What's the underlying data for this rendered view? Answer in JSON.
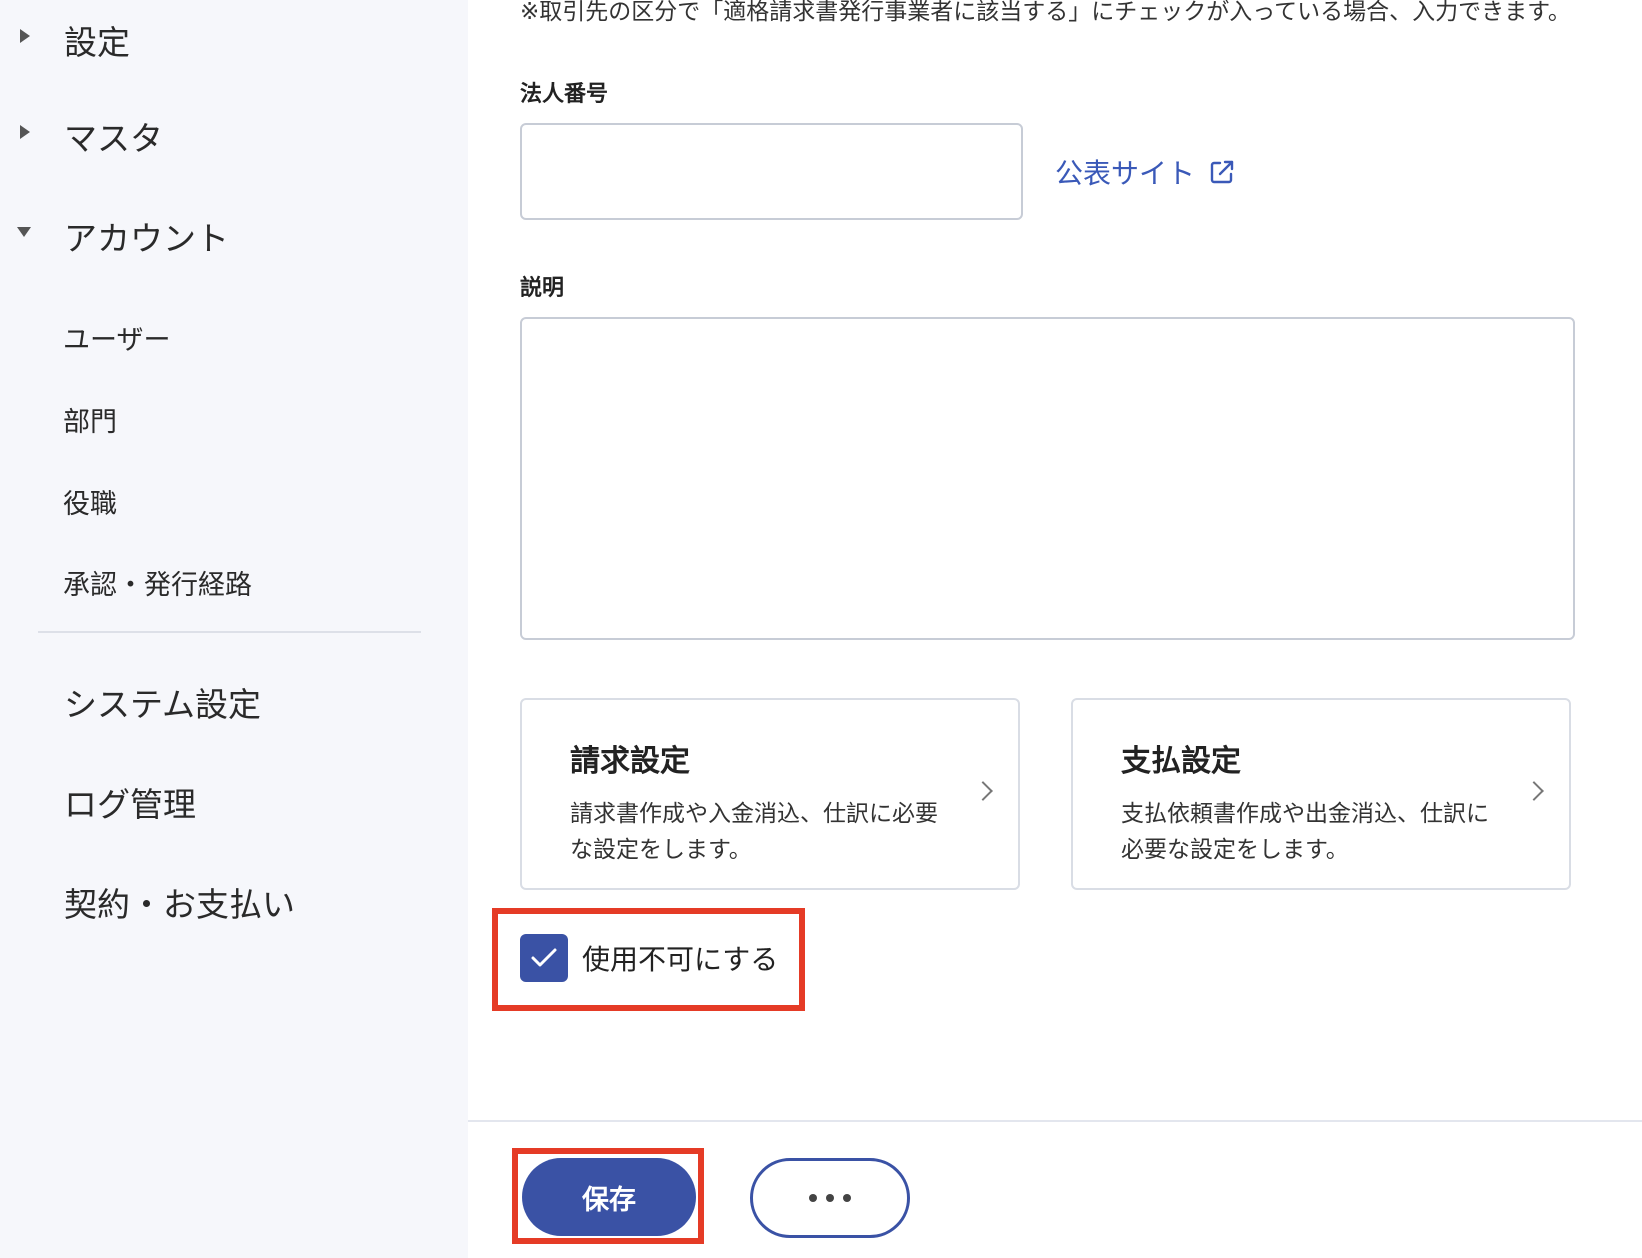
{
  "sidebar": {
    "groups": [
      {
        "label": "設定",
        "expanded": false
      },
      {
        "label": "マスタ",
        "expanded": false
      },
      {
        "label": "アカウント",
        "expanded": true
      }
    ],
    "sub_items": [
      "ユーザー",
      "部門",
      "役職",
      "承認・発行経路"
    ],
    "top_items": [
      "システム設定",
      "ログ管理",
      "契約・お支払い"
    ]
  },
  "main": {
    "note": "※取引先の区分で「適格請求書発行事業者に該当する」にチェックが入っている場合、入力できます。",
    "corporate_number": {
      "label": "法人番号",
      "value": "",
      "link": "公表サイト"
    },
    "description": {
      "label": "説明",
      "value": ""
    },
    "cards": [
      {
        "title": "請求設定",
        "desc": "請求書作成や入金消込、仕訳に必要な設定をします。"
      },
      {
        "title": "支払設定",
        "desc": "支払依頼書作成や出金消込、仕訳に必要な設定をします。"
      }
    ],
    "disable_checkbox": {
      "label": "使用不可にする",
      "checked": true
    }
  },
  "footer": {
    "save_label": "保存"
  },
  "colors": {
    "accent": "#3a52a5",
    "link": "#3a59b8",
    "highlight": "#e53b26",
    "sidebar_bg": "#f6f7fb"
  }
}
